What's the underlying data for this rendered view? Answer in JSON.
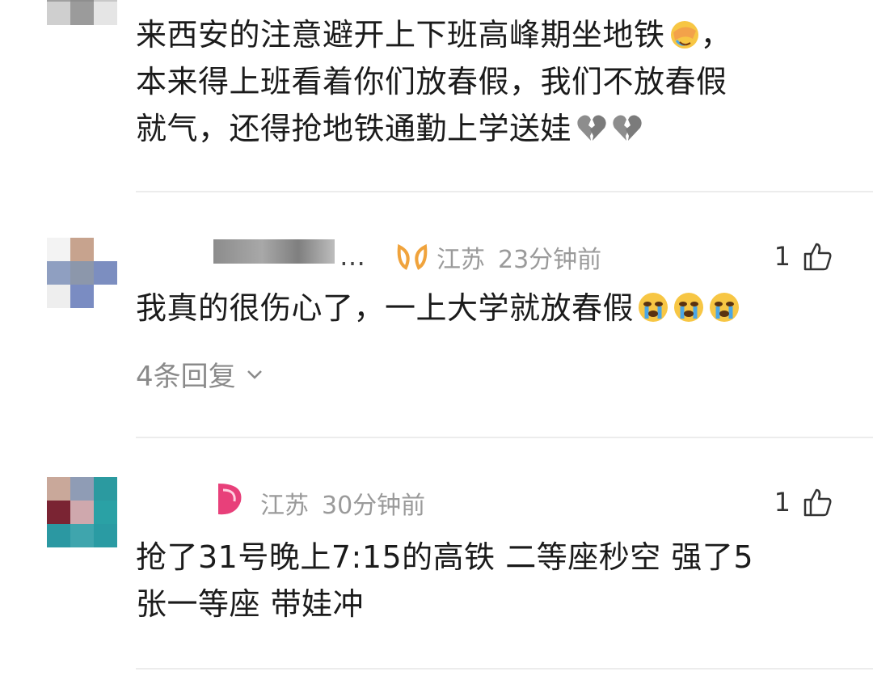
{
  "comments": [
    {
      "text": "来西安的注意避开上下班高峰期坐地铁",
      "text_tail1": "，\n本来得上班看着你们放春假，我们不放春假\n就气，还得抢地铁通勤上学送娃",
      "emoji_facepalm": "face-palm-crying",
      "emoji_broken": "broken-heart"
    },
    {
      "username_tail": "…",
      "location": "江苏",
      "time": "23分钟前",
      "likes": "1",
      "text": "我真的很伤心了，一上大学就放春假",
      "emoji": "loudly-crying-face",
      "replies": "4条回复"
    },
    {
      "location": "江苏",
      "time": "30分钟前",
      "likes": "1",
      "text": "抢了31号晚上7:15的高铁 二等座秒空 强了5\n张一等座 带娃冲"
    }
  ],
  "colors": {
    "badge_orange": "#f0a33c",
    "badge_pink": "#e8407a"
  }
}
